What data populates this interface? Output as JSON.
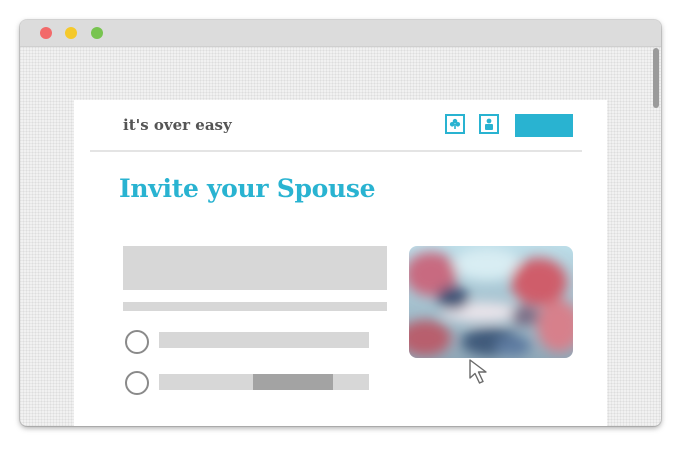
{
  "app": {
    "brand": "it's over easy"
  },
  "colors": {
    "accent": "#29b3d1",
    "placeholder": "#d7d7d7",
    "placeholder_selected": "#a3a3a3",
    "close": "#f26a6a",
    "minimize": "#f5c92b",
    "maximize": "#78c450"
  },
  "icons": {
    "nav_1": "club-icon",
    "nav_2": "person-icon",
    "cursor": "arrow-cursor-icon"
  },
  "page": {
    "title": "Invite your Spouse"
  },
  "options": [
    {
      "selected": false
    },
    {
      "selected": false
    }
  ]
}
